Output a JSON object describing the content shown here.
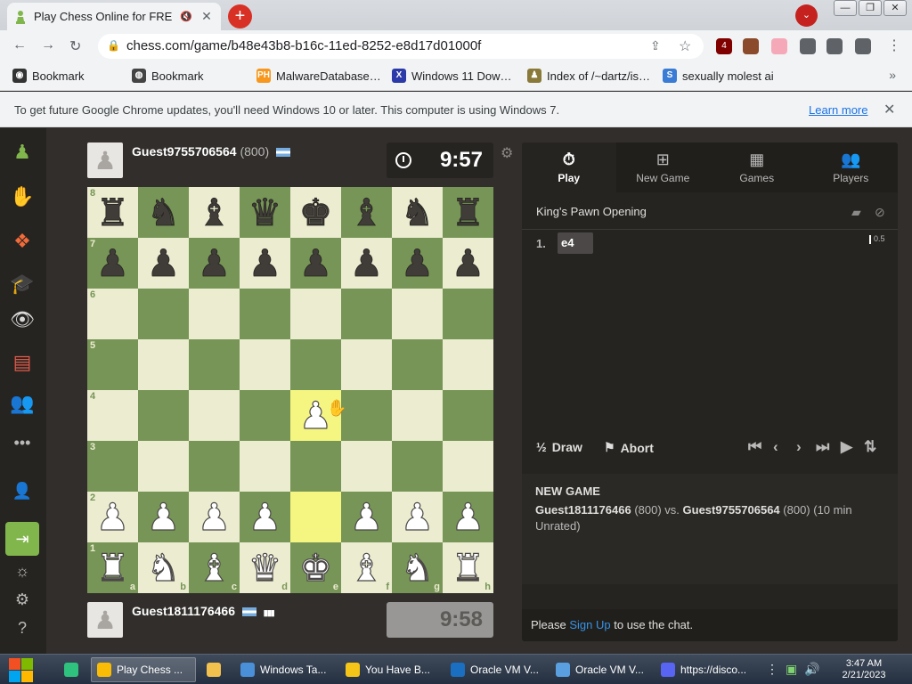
{
  "browser": {
    "tab_title": "Play Chess Online for FREE",
    "tab_close": "✕",
    "new_tab": "+",
    "url": "chess.com/game/b48e43b8-b16c-11ed-8252-e8d17d01000f",
    "window_buttons": [
      "—",
      "❐",
      "✕"
    ],
    "extensions": [
      {
        "icon": "ublock-icon",
        "badge": "4",
        "color": "#800000"
      },
      {
        "icon": "avatar-extension-icon",
        "color": "#8b4a2b"
      },
      {
        "icon": "flag-extension-icon",
        "color": "#f5a9b8"
      },
      {
        "icon": "puzzle-icon",
        "color": "#5f6368"
      },
      {
        "icon": "sidepanel-icon",
        "color": "#5f6368"
      },
      {
        "icon": "profile-icon",
        "color": "#5f6368"
      }
    ]
  },
  "bookmarks": [
    {
      "label": "Bookmark",
      "icon": "github-icon",
      "color": "#333333",
      "glyph": "◉"
    },
    {
      "label": "Bookmark",
      "icon": "globe-icon",
      "color": "#444444",
      "glyph": "◍"
    },
    {
      "label": "MalwareDatabase…",
      "icon": "ph-icon",
      "color": "#f7971d",
      "glyph": "PH"
    },
    {
      "label": "Windows 11 Dow…",
      "icon": "x-icon",
      "color": "#2b3aa8",
      "glyph": "X"
    },
    {
      "label": "Index of /~dartz/is…",
      "icon": "apache-icon",
      "color": "#8a7a3a",
      "glyph": "♟"
    },
    {
      "label": "sexually molest ai",
      "icon": "bookmark-icon",
      "color": "#3a7bd5",
      "glyph": "S"
    }
  ],
  "infobar": {
    "message": "To get future Google Chrome updates, you'll need Windows 10 or later. This computer is using Windows 7.",
    "learn_more": "Learn more"
  },
  "game": {
    "top_player": {
      "name": "Guest9755706564",
      "rating": "(800)",
      "clock": "9:57"
    },
    "bottom_player": {
      "name": "Guest1811176466",
      "clock": "9:58"
    },
    "files": [
      "a",
      "b",
      "c",
      "d",
      "e",
      "f",
      "g",
      "h"
    ],
    "ranks": [
      "8",
      "7",
      "6",
      "5",
      "4",
      "3",
      "2",
      "1"
    ],
    "position": [
      [
        "bR",
        "bN",
        "bB",
        "bQ",
        "bK",
        "bB",
        "bN",
        "bR"
      ],
      [
        "bP",
        "bP",
        "bP",
        "bP",
        "bP",
        "bP",
        "bP",
        "bP"
      ],
      [
        "",
        "",
        "",
        "",
        "",
        "",
        "",
        ""
      ],
      [
        "",
        "",
        "",
        "",
        "",
        "",
        "",
        ""
      ],
      [
        "",
        "",
        "",
        "",
        "wP",
        "",
        "",
        ""
      ],
      [
        "",
        "",
        "",
        "",
        "",
        "",
        "",
        ""
      ],
      [
        "wP",
        "wP",
        "wP",
        "wP",
        "",
        "wP",
        "wP",
        "wP"
      ],
      [
        "wR",
        "wN",
        "wB",
        "wQ",
        "wK",
        "wB",
        "wN",
        "wR"
      ]
    ],
    "highlighted_squares": [
      "e4",
      "e2"
    ],
    "last_move_to": "e4"
  },
  "panel": {
    "tabs": [
      {
        "label": "Play",
        "icon": "stopwatch-icon",
        "glyph": "⏱"
      },
      {
        "label": "New Game",
        "icon": "plus-square-icon",
        "glyph": "⊞"
      },
      {
        "label": "Games",
        "icon": "board-icon",
        "glyph": "▦"
      },
      {
        "label": "Players",
        "icon": "players-icon",
        "glyph": "👥"
      }
    ],
    "opening": "King's Pawn Opening",
    "move_number": "1.",
    "move": "e4",
    "eval": "0.5",
    "draw": "Draw",
    "draw_glyph": "½",
    "abort": "Abort",
    "game_title": "NEW GAME",
    "game_white": "Guest1811176466",
    "game_white_rating": " (800) vs. ",
    "game_black": "Guest9755706564",
    "game_black_rating": " (800) (10 min Unrated)",
    "chat_pre": "Please ",
    "chat_link": "Sign Up",
    "chat_post": " to use the chat."
  },
  "taskbar": {
    "items": [
      {
        "label": "",
        "icon": "sticky-notes-icon",
        "color": "#2ec27e"
      },
      {
        "label": "Play Chess ...",
        "icon": "chrome-icon",
        "color": "#fbbc05",
        "active": true
      },
      {
        "label": "",
        "icon": "folder-icon",
        "color": "#f2c14e"
      },
      {
        "label": "Windows Ta...",
        "icon": "task-manager-icon",
        "color": "#4a90d9"
      },
      {
        "label": "You Have B...",
        "icon": "warning-icon",
        "color": "#f5c518"
      },
      {
        "label": "Oracle VM V...",
        "icon": "virtualbox-icon",
        "color": "#1a6fc1"
      },
      {
        "label": "Oracle VM V...",
        "icon": "virtualbox-cube-icon",
        "color": "#5aa0e0"
      },
      {
        "label": "https://disco...",
        "icon": "discord-icon",
        "color": "#5865f2"
      }
    ],
    "time": "3:47 AM",
    "date": "2/21/2023"
  }
}
